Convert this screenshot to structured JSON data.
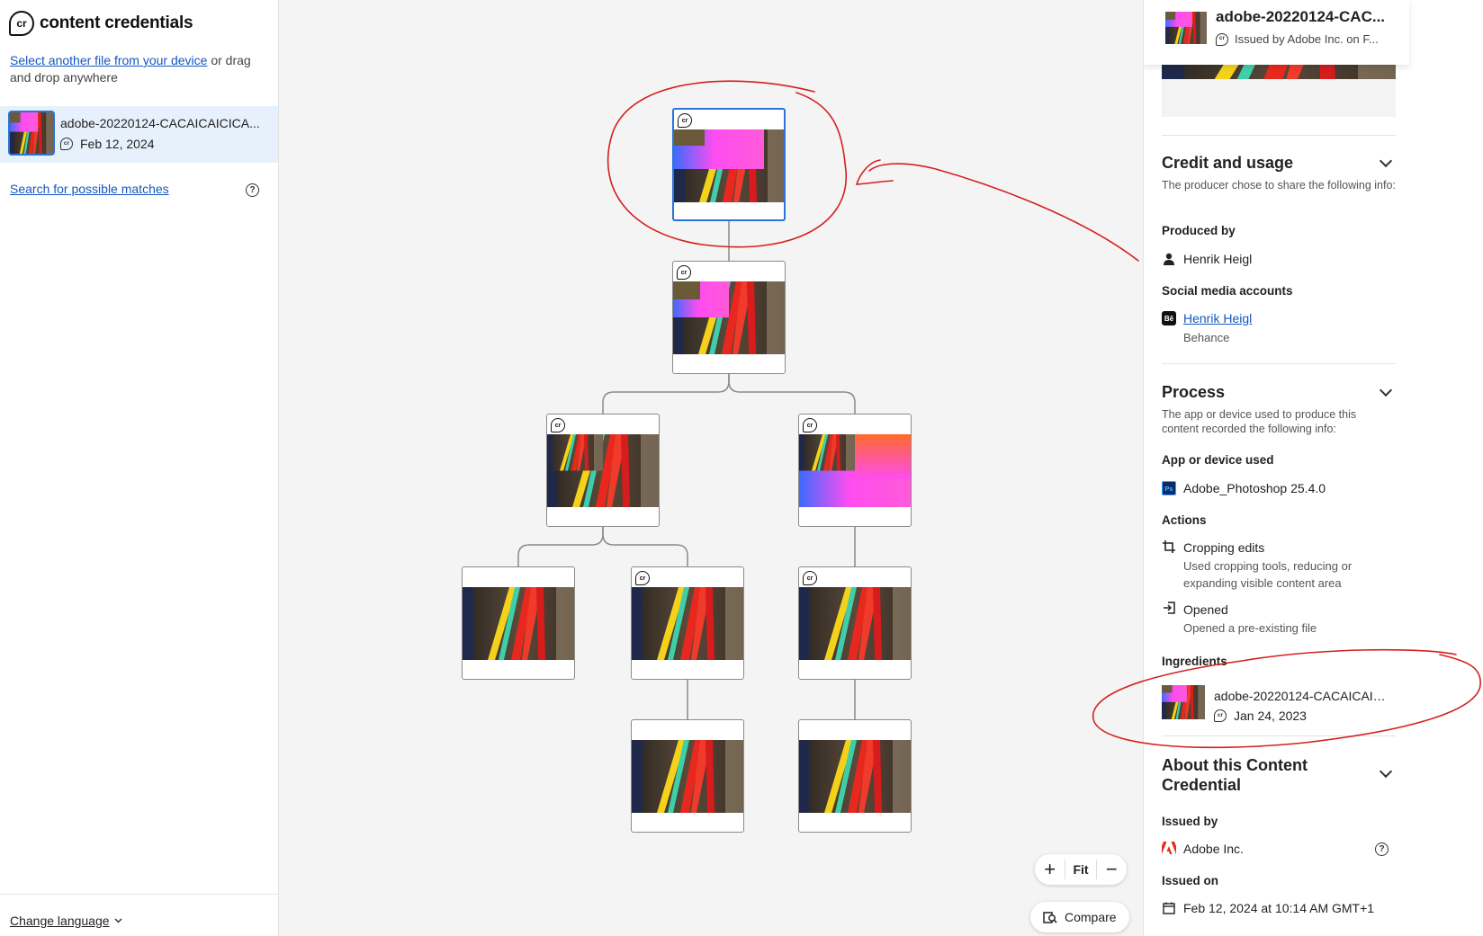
{
  "brand": {
    "logo_mark": "cr",
    "name": "content credentials"
  },
  "sidebar": {
    "upload_link": "Select another file from your device",
    "upload_rest": " or drag and drop anywhere",
    "file": {
      "name": "adobe-20220124-CACAICAICICA...",
      "date": "Feb 12, 2024"
    },
    "search_link": "Search for possible matches",
    "change_language": "Change language"
  },
  "canvas": {
    "badge": "cr",
    "zoom": {
      "in": "+",
      "fit": "Fit",
      "out": "−"
    },
    "compare": "Compare"
  },
  "panel": {
    "header": {
      "title": "adobe-20220124-CAC...",
      "issued": "Issued by Adobe Inc. on F..."
    },
    "credit": {
      "title": "Credit and usage",
      "desc": "The producer chose to share the following info:",
      "produced_label": "Produced by",
      "producer": "Henrik Heigl",
      "social_label": "Social media accounts",
      "social_name": "Henrik Heigl",
      "social_site": "Behance"
    },
    "process": {
      "title": "Process",
      "desc": "The app or device used to produce this content recorded the following info:",
      "app_label": "App or device used",
      "app": "Adobe_Photoshop 25.4.0",
      "actions_label": "Actions",
      "action1_title": "Cropping edits",
      "action1_desc": "Used cropping tools, reducing or expanding visible content area",
      "action2_title": "Opened",
      "action2_desc": "Opened a pre-existing file",
      "ingredients_label": "Ingredients",
      "ingredient_name": "adobe-20220124-CACAICAICI...",
      "ingredient_date": "Jan 24, 2023"
    },
    "about": {
      "title": "About this Content Credential",
      "issued_by_label": "Issued by",
      "issuer": "Adobe Inc.",
      "issued_on_label": "Issued on",
      "issued_on": "Feb 12, 2024 at 10:14 AM GMT+1"
    }
  },
  "colors": {
    "accent": "#2a73d9",
    "link": "#1557c0",
    "annotation": "#d42020",
    "selected_bg": "#e6f1fb"
  }
}
